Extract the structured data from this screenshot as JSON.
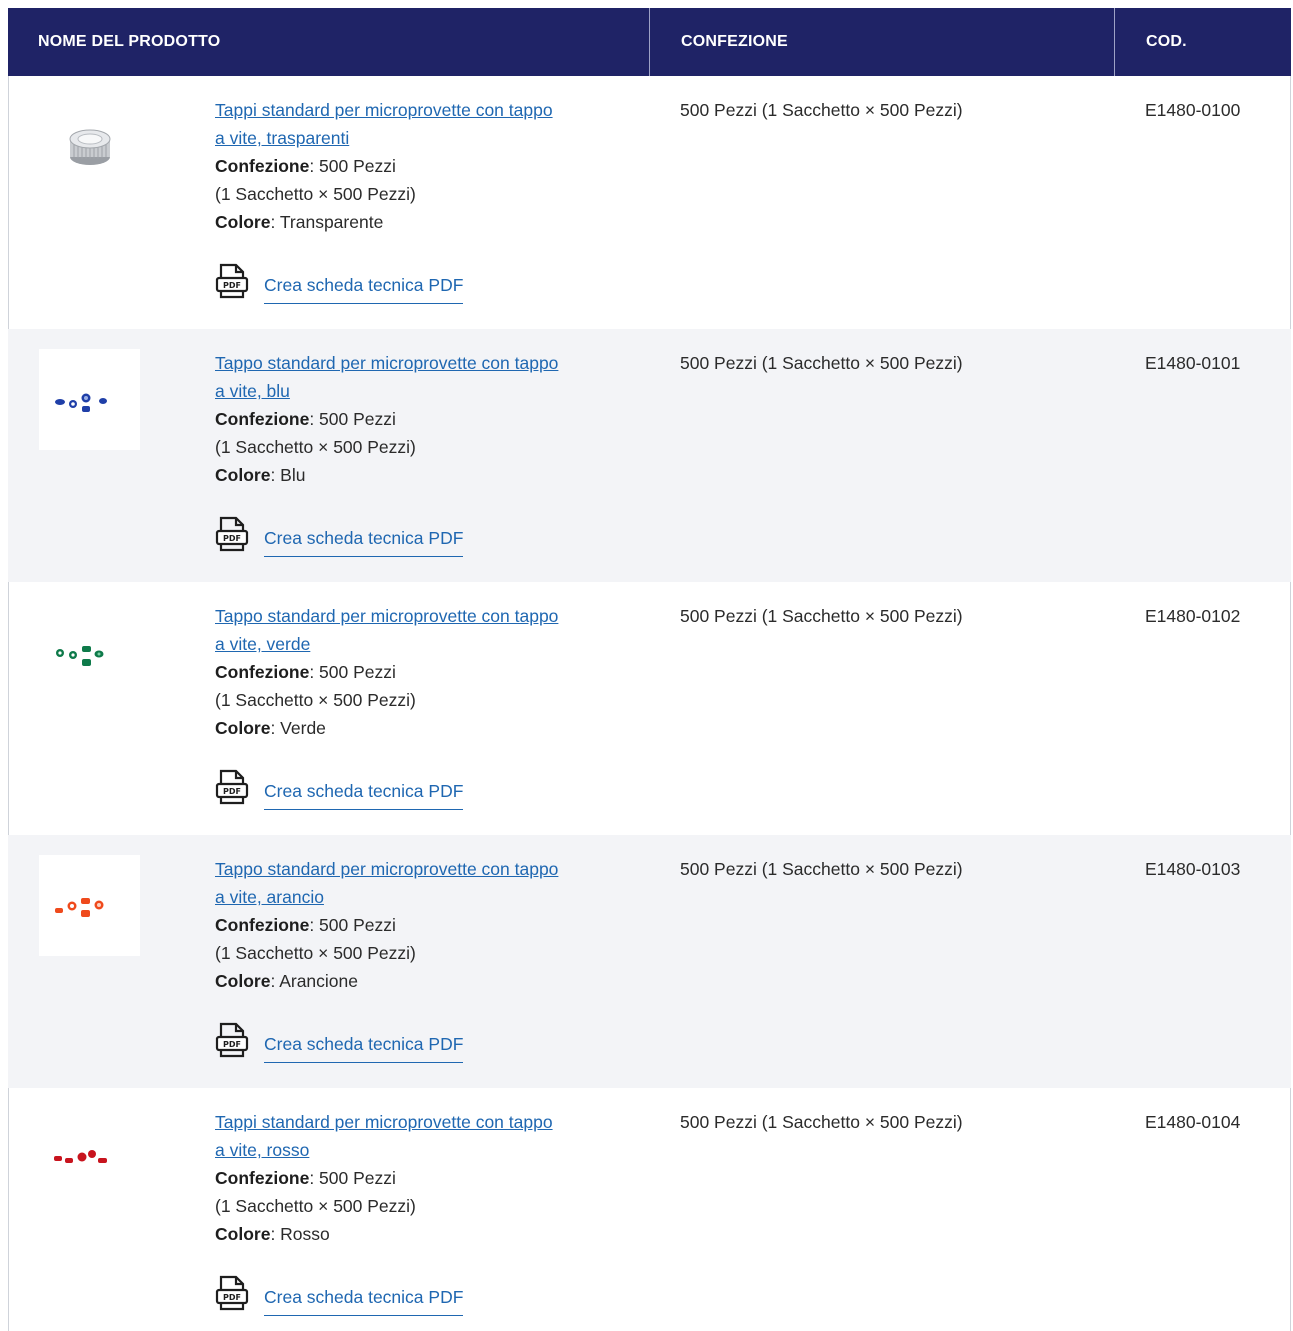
{
  "columns": {
    "name": "NOME DEL PRODOTTO",
    "package": "CONFEZIONE",
    "code": "COD."
  },
  "labels": {
    "package_label": "Confezione",
    "color_label": "Colore",
    "pdf_link": "Crea scheda tecnica PDF"
  },
  "rows": [
    {
      "name_line1": "Tappi standard per microprovette con tappo",
      "name_line2": "a vite, trasparenti",
      "pack_short": "500 Pezzi",
      "pack_detail": "(1 Sacchetto × 500 Pezzi)",
      "color": "Transparente",
      "pack_full": "500 Pezzi (1 Sacchetto × 500 Pezzi)",
      "code": "E1480-0100",
      "swatch": "#c9ccd0"
    },
    {
      "name_line1": "Tappo standard per microprovette con tappo",
      "name_line2": "a vite, blu",
      "pack_short": "500 Pezzi",
      "pack_detail": "(1 Sacchetto × 500 Pezzi)",
      "color": "Blu",
      "pack_full": "500 Pezzi (1 Sacchetto × 500 Pezzi)",
      "code": "E1480-0101",
      "swatch": "#1f3fa8"
    },
    {
      "name_line1": "Tappo standard per microprovette con tappo",
      "name_line2": "a vite, verde",
      "pack_short": "500 Pezzi",
      "pack_detail": "(1 Sacchetto × 500 Pezzi)",
      "color": "Verde",
      "pack_full": "500 Pezzi (1 Sacchetto × 500 Pezzi)",
      "code": "E1480-0102",
      "swatch": "#0e7a4a"
    },
    {
      "name_line1": "Tappo standard per microprovette con tappo",
      "name_line2": "a vite, arancio",
      "pack_short": "500 Pezzi",
      "pack_detail": "(1 Sacchetto × 500 Pezzi)",
      "color": "Arancione",
      "pack_full": "500 Pezzi (1 Sacchetto × 500 Pezzi)",
      "code": "E1480-0103",
      "swatch": "#ef4a1c"
    },
    {
      "name_line1": "Tappi standard per microprovette con tappo",
      "name_line2": "a vite, rosso",
      "pack_short": "500 Pezzi",
      "pack_detail": "(1 Sacchetto × 500 Pezzi)",
      "color": "Rosso",
      "pack_full": "500 Pezzi (1 Sacchetto × 500 Pezzi)",
      "code": "E1480-0104",
      "swatch": "#c8141e"
    }
  ]
}
